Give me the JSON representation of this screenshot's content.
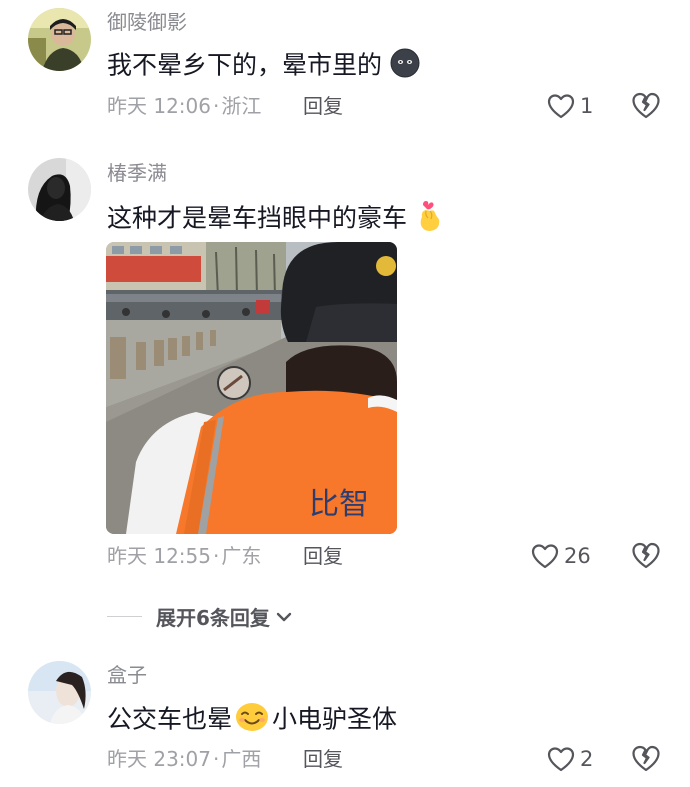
{
  "comments": [
    {
      "username": "御陵御影",
      "text": "我不晕乡下的，晕市里的",
      "time": "昨天 12:06",
      "location": "浙江",
      "reply_label": "回复",
      "likes": "1",
      "emoji": "dark-face-emoji"
    },
    {
      "username": "椿季满",
      "text": "这种才是晕车挡眼中的豪车",
      "time": "昨天 12:55",
      "location": "广东",
      "reply_label": "回复",
      "likes": "26",
      "emoji": "finger-heart-emoji",
      "image": {
        "overlay_text": "比智"
      }
    },
    {
      "username": "盒子",
      "text_before": "公交车也晕",
      "text_after": "小电驴圣体",
      "time": "昨天 23:07",
      "location": "广西",
      "reply_label": "回复",
      "likes": "2",
      "emoji": "smile-emoji"
    }
  ],
  "expand_replies": {
    "label": "展开6条回复"
  },
  "colors": {
    "text": "#161823",
    "meta": "#a0a1a6",
    "username": "#8a8b91",
    "icon": "#55565c",
    "vest": "#f7782a"
  }
}
